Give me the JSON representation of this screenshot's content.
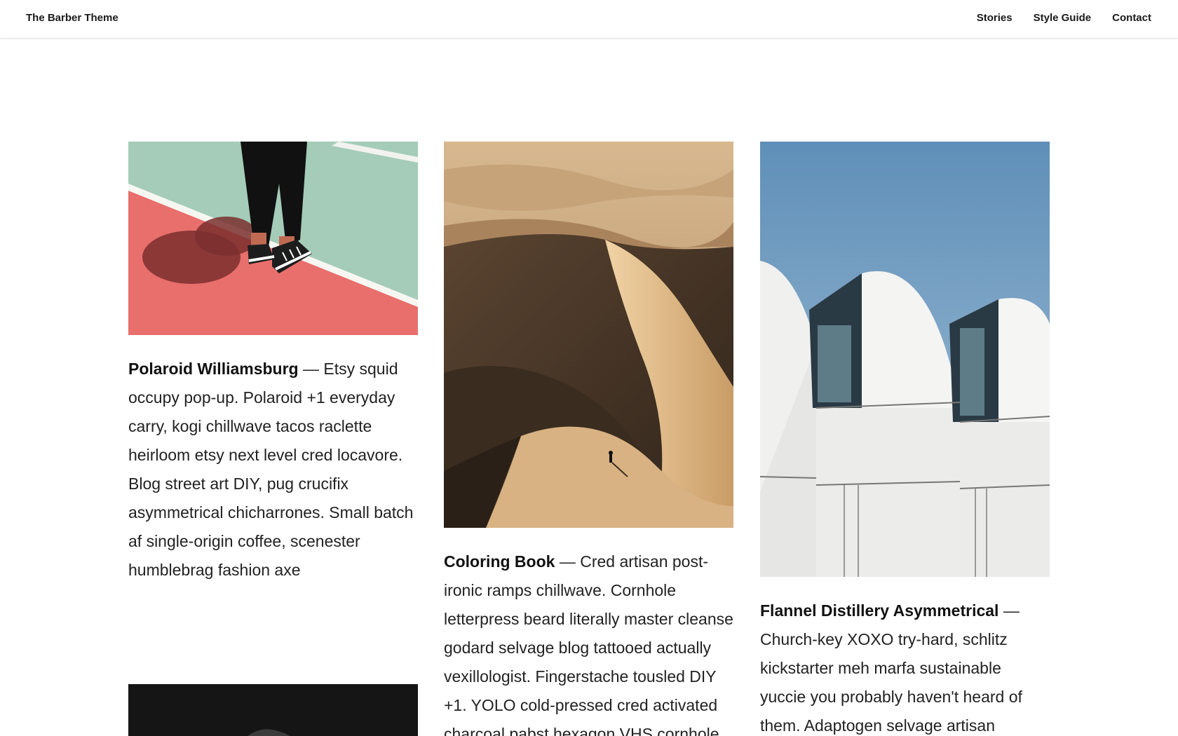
{
  "site": {
    "title": "The Barber Theme"
  },
  "nav": {
    "items": [
      "Stories",
      "Style Guide",
      "Contact"
    ]
  },
  "posts": [
    {
      "title": "Polaroid Williamsburg",
      "separator": " — ",
      "excerpt": "Etsy squid occupy pop-up. Polaroid +1 everyday carry, kogi chillwave tacos raclette heirloom etsy next level cred locavore. Blog street art DIY, pug crucifix asymmetrical chicharrones. Small batch af single-origin coffee, scenester humblebrag fashion axe",
      "image": "sneakers-on-court-image"
    },
    {
      "title": "Coloring Book",
      "separator": " — ",
      "excerpt": "Cred artisan post-ironic ramps chillwave. Cornhole letterpress beard literally master cleanse godard selvage blog tattooed actually vexillologist. Fingerstache tousled DIY +1. YOLO cold-pressed cred activated charcoal pabst hexagon VHS cornhole",
      "image": "desert-dunes-image"
    },
    {
      "title": "Flannel Distillery Asymmetrical",
      "separator": " —",
      "excerpt": "Church-key XOXO try-hard, schlitz kickstarter meh marfa sustainable yuccie you probably haven't heard of them. Adaptogen selvage artisan franzen",
      "image": "white-arched-building-image"
    },
    {
      "title": "",
      "separator": "",
      "excerpt": "",
      "image": "dark-photo-image"
    }
  ]
}
